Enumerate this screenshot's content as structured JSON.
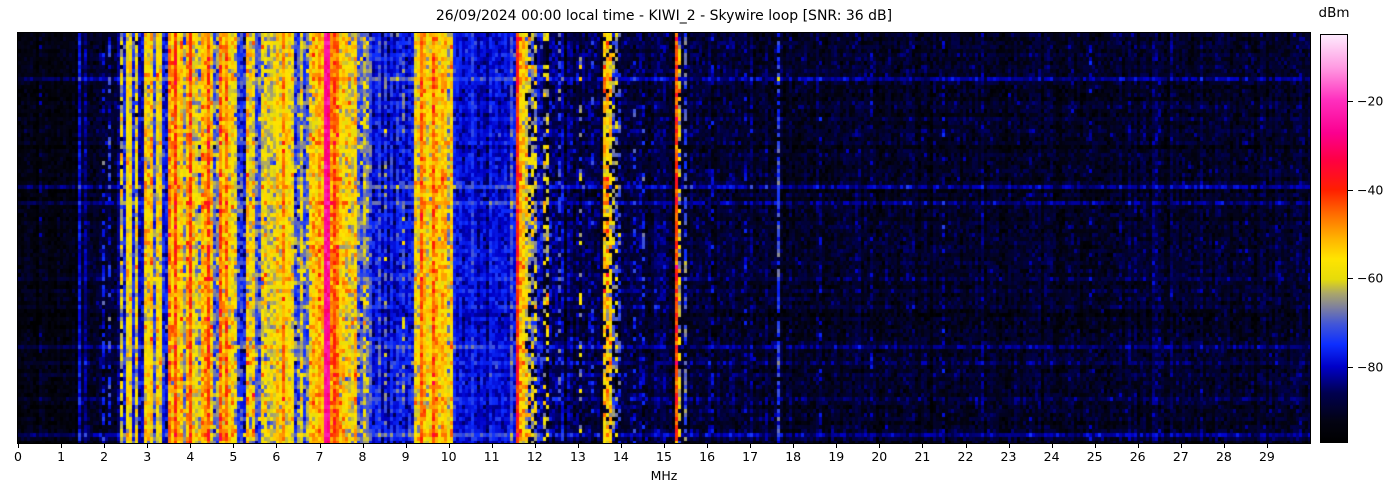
{
  "chart_data": {
    "type": "heatmap",
    "title": "26/09/2024 00:00 local time - KIWI_2 - Skywire loop [SNR: 36 dB]",
    "xlabel": "MHz",
    "colorbar_label": "dBm",
    "x_range": [
      0,
      30
    ],
    "x_ticks": [
      0,
      1,
      2,
      3,
      4,
      5,
      6,
      7,
      8,
      9,
      10,
      11,
      12,
      13,
      14,
      15,
      16,
      17,
      18,
      19,
      20,
      21,
      22,
      23,
      24,
      25,
      26,
      27,
      28,
      29
    ],
    "colorbar_ticks": [
      -20,
      -40,
      -60,
      -80
    ],
    "value_range_dbm": [
      -97,
      -5
    ],
    "grid": false,
    "legend_position": "colorbar-right",
    "y_axis": "time (rows, unlabeled)",
    "colormap_stops": [
      [
        0.0,
        "#000000"
      ],
      [
        0.05,
        "#030312"
      ],
      [
        0.12,
        "#00004f"
      ],
      [
        0.185,
        "#0000c8"
      ],
      [
        0.24,
        "#0d2fff"
      ],
      [
        0.29,
        "#4256d8"
      ],
      [
        0.33,
        "#7d7f9f"
      ],
      [
        0.365,
        "#aaa66a"
      ],
      [
        0.4,
        "#e6dc0a"
      ],
      [
        0.45,
        "#ffe400"
      ],
      [
        0.5,
        "#ffb300"
      ],
      [
        0.56,
        "#ff6c00"
      ],
      [
        0.62,
        "#ff1e00"
      ],
      [
        0.69,
        "#ff0040"
      ],
      [
        0.76,
        "#fb0090"
      ],
      [
        0.84,
        "#ff2fbe"
      ],
      [
        0.92,
        "#ff9ae2"
      ],
      [
        1.0,
        "#fdeafd"
      ]
    ],
    "background_level_dbm": -90.5,
    "noise_sd_db": 3,
    "bands_format": [
      "f_start_mhz",
      "f_end_mhz",
      "mean_level_dbm",
      "sd_db",
      "duty_cycle"
    ],
    "bands": [
      [
        0.0,
        1.4,
        -93,
        2.2,
        1
      ],
      [
        0.5,
        0.54,
        -86,
        3,
        0.35
      ],
      [
        0.95,
        0.99,
        -87,
        3,
        0.3
      ],
      [
        1.4,
        1.47,
        -80,
        2.5,
        1
      ],
      [
        1.47,
        1.56,
        -90,
        2.5,
        1
      ],
      [
        1.56,
        1.63,
        -81,
        2.5,
        1
      ],
      [
        1.63,
        2.3,
        -89,
        3,
        1
      ],
      [
        1.95,
        1.99,
        -77,
        4,
        0.5
      ],
      [
        2.12,
        2.16,
        -75,
        4,
        0.5
      ],
      [
        2.3,
        2.38,
        -82,
        3,
        1
      ],
      [
        2.38,
        2.46,
        -62,
        6,
        0.9
      ],
      [
        2.46,
        2.52,
        -78,
        4,
        1
      ],
      [
        2.52,
        2.64,
        -58,
        5,
        1
      ],
      [
        2.64,
        2.72,
        -75,
        5,
        1
      ],
      [
        2.72,
        2.82,
        -60,
        6,
        0.92
      ],
      [
        2.82,
        2.94,
        -80,
        4,
        1
      ],
      [
        2.94,
        3.1,
        -59,
        6,
        1
      ],
      [
        3.1,
        3.2,
        -74,
        6,
        1
      ],
      [
        3.2,
        3.36,
        -58,
        6,
        1
      ],
      [
        3.36,
        3.48,
        -77,
        5,
        1
      ],
      [
        3.48,
        3.62,
        -52,
        6,
        1
      ],
      [
        3.62,
        3.68,
        -44,
        5,
        1
      ],
      [
        3.68,
        3.8,
        -55,
        6,
        1
      ],
      [
        3.8,
        3.88,
        -60,
        6,
        1
      ],
      [
        3.88,
        3.96,
        -50,
        5,
        1
      ],
      [
        3.96,
        4.04,
        -43,
        4,
        1
      ],
      [
        4.04,
        4.16,
        -56,
        6,
        1
      ],
      [
        4.16,
        4.28,
        -62,
        7,
        1
      ],
      [
        4.28,
        4.36,
        -52,
        6,
        1
      ],
      [
        4.36,
        4.44,
        -44,
        5,
        1
      ],
      [
        4.44,
        4.54,
        -55,
        6,
        1
      ],
      [
        4.54,
        4.68,
        -72,
        7,
        1
      ],
      [
        4.68,
        4.8,
        -54,
        6,
        1
      ],
      [
        4.8,
        4.88,
        -45,
        5,
        1
      ],
      [
        4.88,
        5.08,
        -58,
        6,
        1
      ],
      [
        5.08,
        5.32,
        -74,
        6,
        1
      ],
      [
        5.32,
        5.48,
        -57,
        7,
        1
      ],
      [
        5.48,
        5.62,
        -76,
        6,
        1
      ],
      [
        5.62,
        5.76,
        -63,
        7,
        1
      ],
      [
        5.76,
        6.1,
        -56,
        5,
        1
      ],
      [
        6.1,
        6.18,
        -50,
        5,
        1
      ],
      [
        6.18,
        6.38,
        -57,
        5,
        1
      ],
      [
        6.38,
        6.52,
        -72,
        7,
        1
      ],
      [
        6.52,
        6.64,
        -60,
        6,
        1
      ],
      [
        6.64,
        6.76,
        -68,
        7,
        1
      ],
      [
        6.76,
        6.95,
        -56,
        6,
        1
      ],
      [
        6.95,
        7.13,
        -49,
        5,
        1
      ],
      [
        7.13,
        7.27,
        -26,
        3,
        1
      ],
      [
        7.27,
        7.44,
        -46,
        5,
        1
      ],
      [
        7.44,
        7.58,
        -55,
        6,
        1
      ],
      [
        7.58,
        7.74,
        -62,
        7,
        1
      ],
      [
        7.74,
        7.86,
        -57,
        6,
        1
      ],
      [
        7.86,
        7.98,
        -64,
        7,
        1
      ],
      [
        7.98,
        8.1,
        -60,
        6,
        1
      ],
      [
        8.1,
        8.24,
        -70,
        6,
        1
      ],
      [
        8.24,
        9.18,
        -77,
        4,
        1
      ],
      [
        8.34,
        8.38,
        -62,
        5,
        0.3
      ],
      [
        8.52,
        8.56,
        -68,
        5,
        0.4
      ],
      [
        8.7,
        8.74,
        -63,
        5,
        0.3
      ],
      [
        8.94,
        8.98,
        -66,
        5,
        0.3
      ],
      [
        9.18,
        9.32,
        -56,
        6,
        1
      ],
      [
        9.32,
        9.4,
        -44,
        4,
        1
      ],
      [
        9.4,
        9.58,
        -55,
        5,
        1
      ],
      [
        9.58,
        9.66,
        -46,
        5,
        1
      ],
      [
        9.66,
        9.78,
        -53,
        5,
        1
      ],
      [
        9.78,
        9.94,
        -56,
        5,
        1
      ],
      [
        9.94,
        10.02,
        -62,
        6,
        1
      ],
      [
        10.02,
        10.1,
        -58,
        5,
        1
      ],
      [
        10.1,
        11.44,
        -78,
        3,
        1
      ],
      [
        10.3,
        10.34,
        -72,
        4,
        0.5
      ],
      [
        10.86,
        10.92,
        -82,
        3,
        1
      ],
      [
        11.44,
        11.55,
        -74,
        4,
        1
      ],
      [
        11.55,
        11.66,
        -38,
        4,
        1
      ],
      [
        11.66,
        11.78,
        -52,
        6,
        1
      ],
      [
        11.78,
        11.86,
        -58,
        6,
        0.9
      ],
      [
        11.86,
        12.06,
        -64,
        7,
        0.7
      ],
      [
        12.06,
        12.22,
        -80,
        5,
        1
      ],
      [
        12.22,
        12.32,
        -60,
        6,
        0.45
      ],
      [
        12.32,
        12.56,
        -84,
        4,
        1
      ],
      [
        12.56,
        12.61,
        -72,
        5,
        0.4
      ],
      [
        12.61,
        13.02,
        -86,
        4,
        1
      ],
      [
        12.79,
        12.84,
        -73,
        5,
        0.4
      ],
      [
        13.02,
        13.08,
        -64,
        6,
        0.3
      ],
      [
        13.08,
        13.56,
        -87,
        4,
        1
      ],
      [
        13.32,
        13.36,
        -75,
        4,
        0.3
      ],
      [
        13.56,
        13.76,
        -54,
        6,
        0.85
      ],
      [
        13.76,
        13.96,
        -68,
        7,
        0.6
      ],
      [
        13.96,
        14.01,
        -74,
        5,
        0.5
      ],
      [
        14.01,
        15.24,
        -88,
        3.5,
        1
      ],
      [
        14.28,
        14.32,
        -76,
        4,
        0.4
      ],
      [
        14.52,
        14.56,
        -77,
        4,
        0.4
      ],
      [
        14.75,
        14.79,
        -78,
        4,
        0.3
      ],
      [
        15.24,
        15.32,
        -45,
        5,
        1
      ],
      [
        15.32,
        15.38,
        -62,
        6,
        0.7
      ],
      [
        15.38,
        15.46,
        -88,
        3.5,
        1
      ],
      [
        15.46,
        15.51,
        -72,
        4,
        0.6
      ],
      [
        15.51,
        17.46,
        -89,
        3.5,
        1
      ],
      [
        16.1,
        16.14,
        -80,
        3,
        0.4
      ],
      [
        16.86,
        16.9,
        -80,
        3,
        0.3
      ],
      [
        17.46,
        17.51,
        -74,
        4,
        0.8
      ],
      [
        17.51,
        17.63,
        -89,
        3.5,
        1
      ],
      [
        17.63,
        17.68,
        -73,
        4,
        0.8
      ],
      [
        17.68,
        30.0,
        -90,
        3.2,
        1
      ],
      [
        17.96,
        18.0,
        -79,
        4,
        0.4
      ],
      [
        18.6,
        18.64,
        -82,
        3,
        0.3
      ],
      [
        19.8,
        19.84,
        -82,
        3,
        0.3
      ],
      [
        21.46,
        21.5,
        -81,
        3,
        0.3
      ],
      [
        24.9,
        24.94,
        -82,
        3,
        0.25
      ],
      [
        26.5,
        26.54,
        -83,
        3,
        0.2
      ]
    ]
  }
}
